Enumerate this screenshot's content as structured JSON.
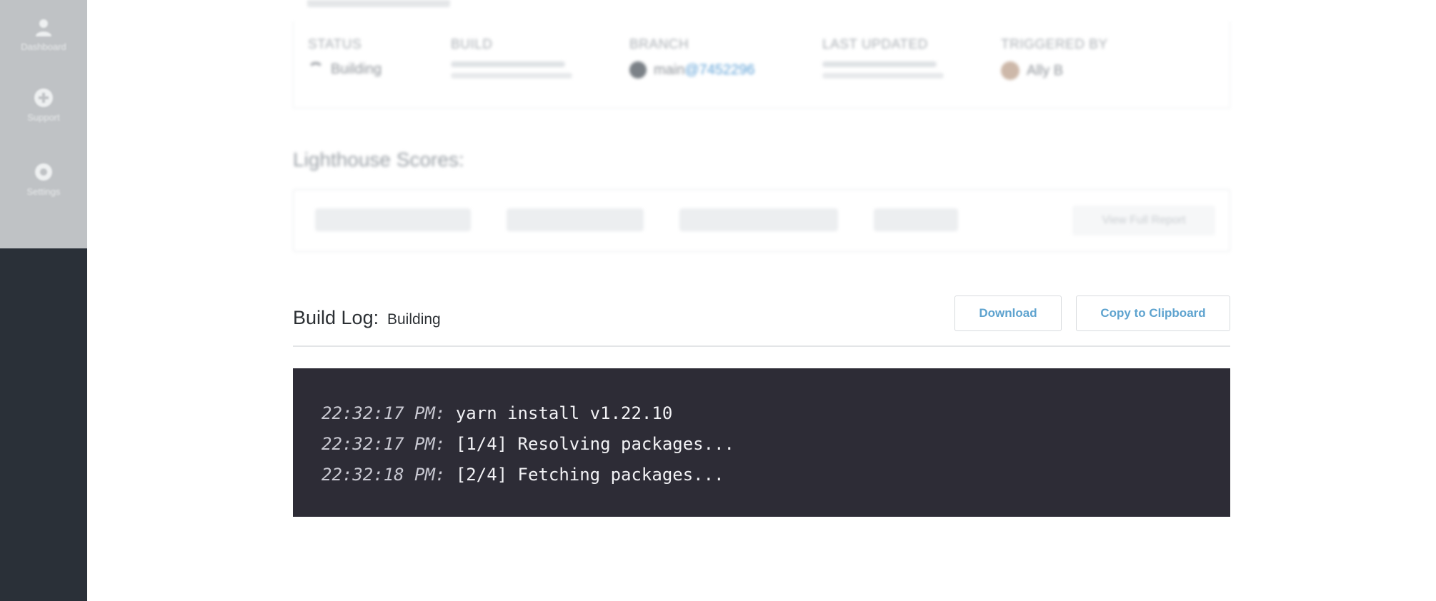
{
  "sidebar": {
    "items": [
      {
        "label": "Dashboard",
        "icon": "user-icon"
      },
      {
        "label": "Support",
        "icon": "plus-circle-icon"
      },
      {
        "label": "Settings",
        "icon": "gear-icon"
      }
    ]
  },
  "summary": {
    "status": {
      "header": "STATUS",
      "value": "Building"
    },
    "build": {
      "header": "BUILD"
    },
    "branch": {
      "header": "BRANCH",
      "name": "main",
      "separator": "@",
      "commit": "7452296"
    },
    "last_updated": {
      "header": "LAST UPDATED"
    },
    "triggered_by": {
      "header": "TRIGGERED BY",
      "user": "Ally B"
    }
  },
  "lighthouse": {
    "title": "Lighthouse Scores:",
    "full_report_label": "View Full Report"
  },
  "build_log": {
    "title": "Build Log:",
    "status": "Building",
    "download_label": "Download",
    "copy_label": "Copy to Clipboard",
    "lines": [
      {
        "time": "22:32:17 PM:",
        "text": "yarn install v1.22.10"
      },
      {
        "time": "22:32:17 PM:",
        "text": "[1/4] Resolving packages..."
      },
      {
        "time": "22:32:18 PM:",
        "text": "[2/4] Fetching packages..."
      }
    ]
  },
  "colors": {
    "sidebar": "#2a3038",
    "terminal_bg": "#2d2c36",
    "accent": "#5ea3cf"
  }
}
